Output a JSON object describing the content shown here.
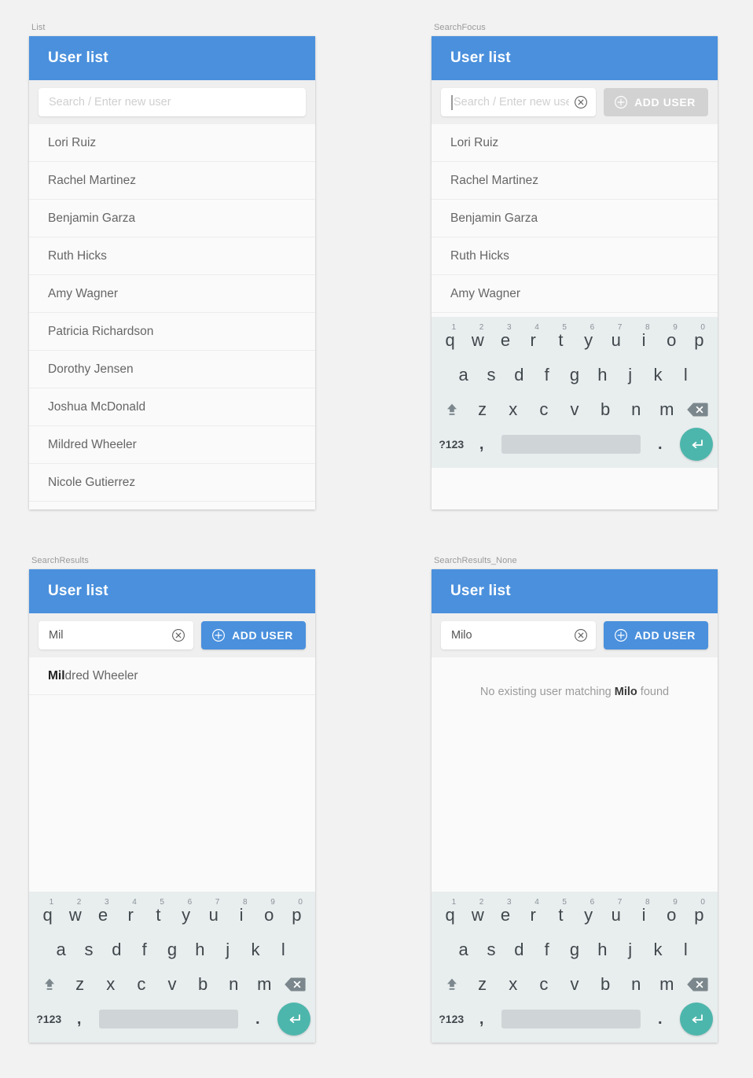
{
  "theme": {
    "accent_blue": "#4a90dd",
    "disabled_gray": "#d2d2d2",
    "keyboard_bg": "#e8edee",
    "enter_key_teal": "#4db6ac",
    "page_bg": "#f2f2f2",
    "panel_bg": "#fafafa"
  },
  "panels": {
    "list": {
      "label": "List",
      "appbar_title": "User list",
      "search": {
        "value": "",
        "placeholder": "Search / Enter new user",
        "has_clear": false,
        "focused": false
      },
      "add_button": {
        "visible": false,
        "label": "ADD USER",
        "enabled": false
      },
      "keyboard_visible": false,
      "users": [
        "Lori Ruiz",
        "Rachel Martinez",
        "Benjamin Garza",
        "Ruth Hicks",
        "Amy Wagner",
        "Patricia Richardson",
        "Dorothy Jensen",
        "Joshua McDonald",
        "Mildred Wheeler",
        "Nicole Gutierrez"
      ]
    },
    "search_focus": {
      "label": "SearchFocus",
      "appbar_title": "User list",
      "search": {
        "value": "",
        "placeholder": "Search / Enter new user",
        "has_clear": true,
        "focused": true
      },
      "add_button": {
        "visible": true,
        "label": "ADD USER",
        "enabled": false
      },
      "keyboard_visible": true,
      "users": [
        "Lori Ruiz",
        "Rachel Martinez",
        "Benjamin Garza",
        "Ruth Hicks",
        "Amy Wagner"
      ]
    },
    "search_results": {
      "label": "SearchResults",
      "appbar_title": "User list",
      "search": {
        "value": "Mil",
        "placeholder": "Search / Enter new user",
        "has_clear": true,
        "focused": false
      },
      "add_button": {
        "visible": true,
        "label": "ADD USER",
        "enabled": true
      },
      "keyboard_visible": true,
      "query": "Mil",
      "results": [
        {
          "match": "Mil",
          "rest": "dred Wheeler"
        }
      ]
    },
    "search_results_none": {
      "label": "SearchResults_None",
      "appbar_title": "User list",
      "search": {
        "value": "Milo",
        "placeholder": "Search / Enter new user",
        "has_clear": true,
        "focused": false
      },
      "add_button": {
        "visible": true,
        "label": "ADD USER",
        "enabled": true
      },
      "keyboard_visible": true,
      "query": "Milo",
      "empty_message": {
        "prefix": "No existing user matching ",
        "query": "Milo",
        "suffix": " found"
      }
    }
  },
  "keyboard": {
    "row1": [
      {
        "key": "q",
        "num": "1"
      },
      {
        "key": "w",
        "num": "2"
      },
      {
        "key": "e",
        "num": "3"
      },
      {
        "key": "r",
        "num": "4"
      },
      {
        "key": "t",
        "num": "5"
      },
      {
        "key": "y",
        "num": "6"
      },
      {
        "key": "u",
        "num": "7"
      },
      {
        "key": "i",
        "num": "8"
      },
      {
        "key": "o",
        "num": "9"
      },
      {
        "key": "p",
        "num": "0"
      }
    ],
    "row2": [
      "a",
      "s",
      "d",
      "f",
      "g",
      "h",
      "j",
      "k",
      "l"
    ],
    "row3": [
      "z",
      "x",
      "c",
      "v",
      "b",
      "n",
      "m"
    ],
    "shift_icon": "shift-icon",
    "backspace_icon": "backspace-icon",
    "symbols_key": "?123",
    "comma_key": ",",
    "period_key": ".",
    "space_key": "",
    "enter_icon": "enter-icon"
  },
  "icons": {
    "clear": "clear-circle-x-icon",
    "add": "plus-circle-icon"
  }
}
